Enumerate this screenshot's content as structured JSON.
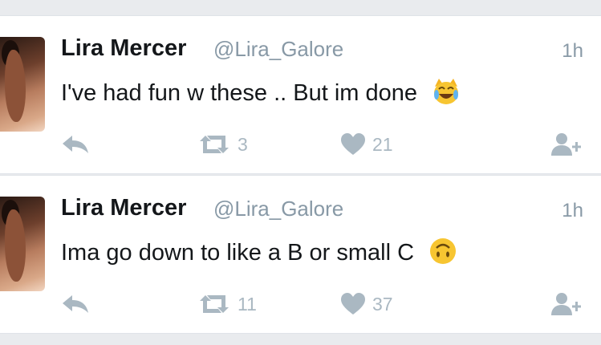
{
  "tweets": [
    {
      "name": "Lira Mercer",
      "handle": "@Lira_Galore",
      "time": "1h",
      "text": "I've had fun w these .. But im done",
      "emoji": "crying-laughing-cat-emoji",
      "retweets": "3",
      "likes": "21"
    },
    {
      "name": "Lira Mercer",
      "handle": "@Lira_Galore",
      "time": "1h",
      "text": "Ima go down to like a B or small C",
      "emoji": "upside-down-face-emoji",
      "retweets": "11",
      "likes": "37"
    }
  ],
  "colors": {
    "text": "#14171a",
    "muted": "#8899a6",
    "icon": "#aab8c2",
    "background": "#e9ebee"
  }
}
